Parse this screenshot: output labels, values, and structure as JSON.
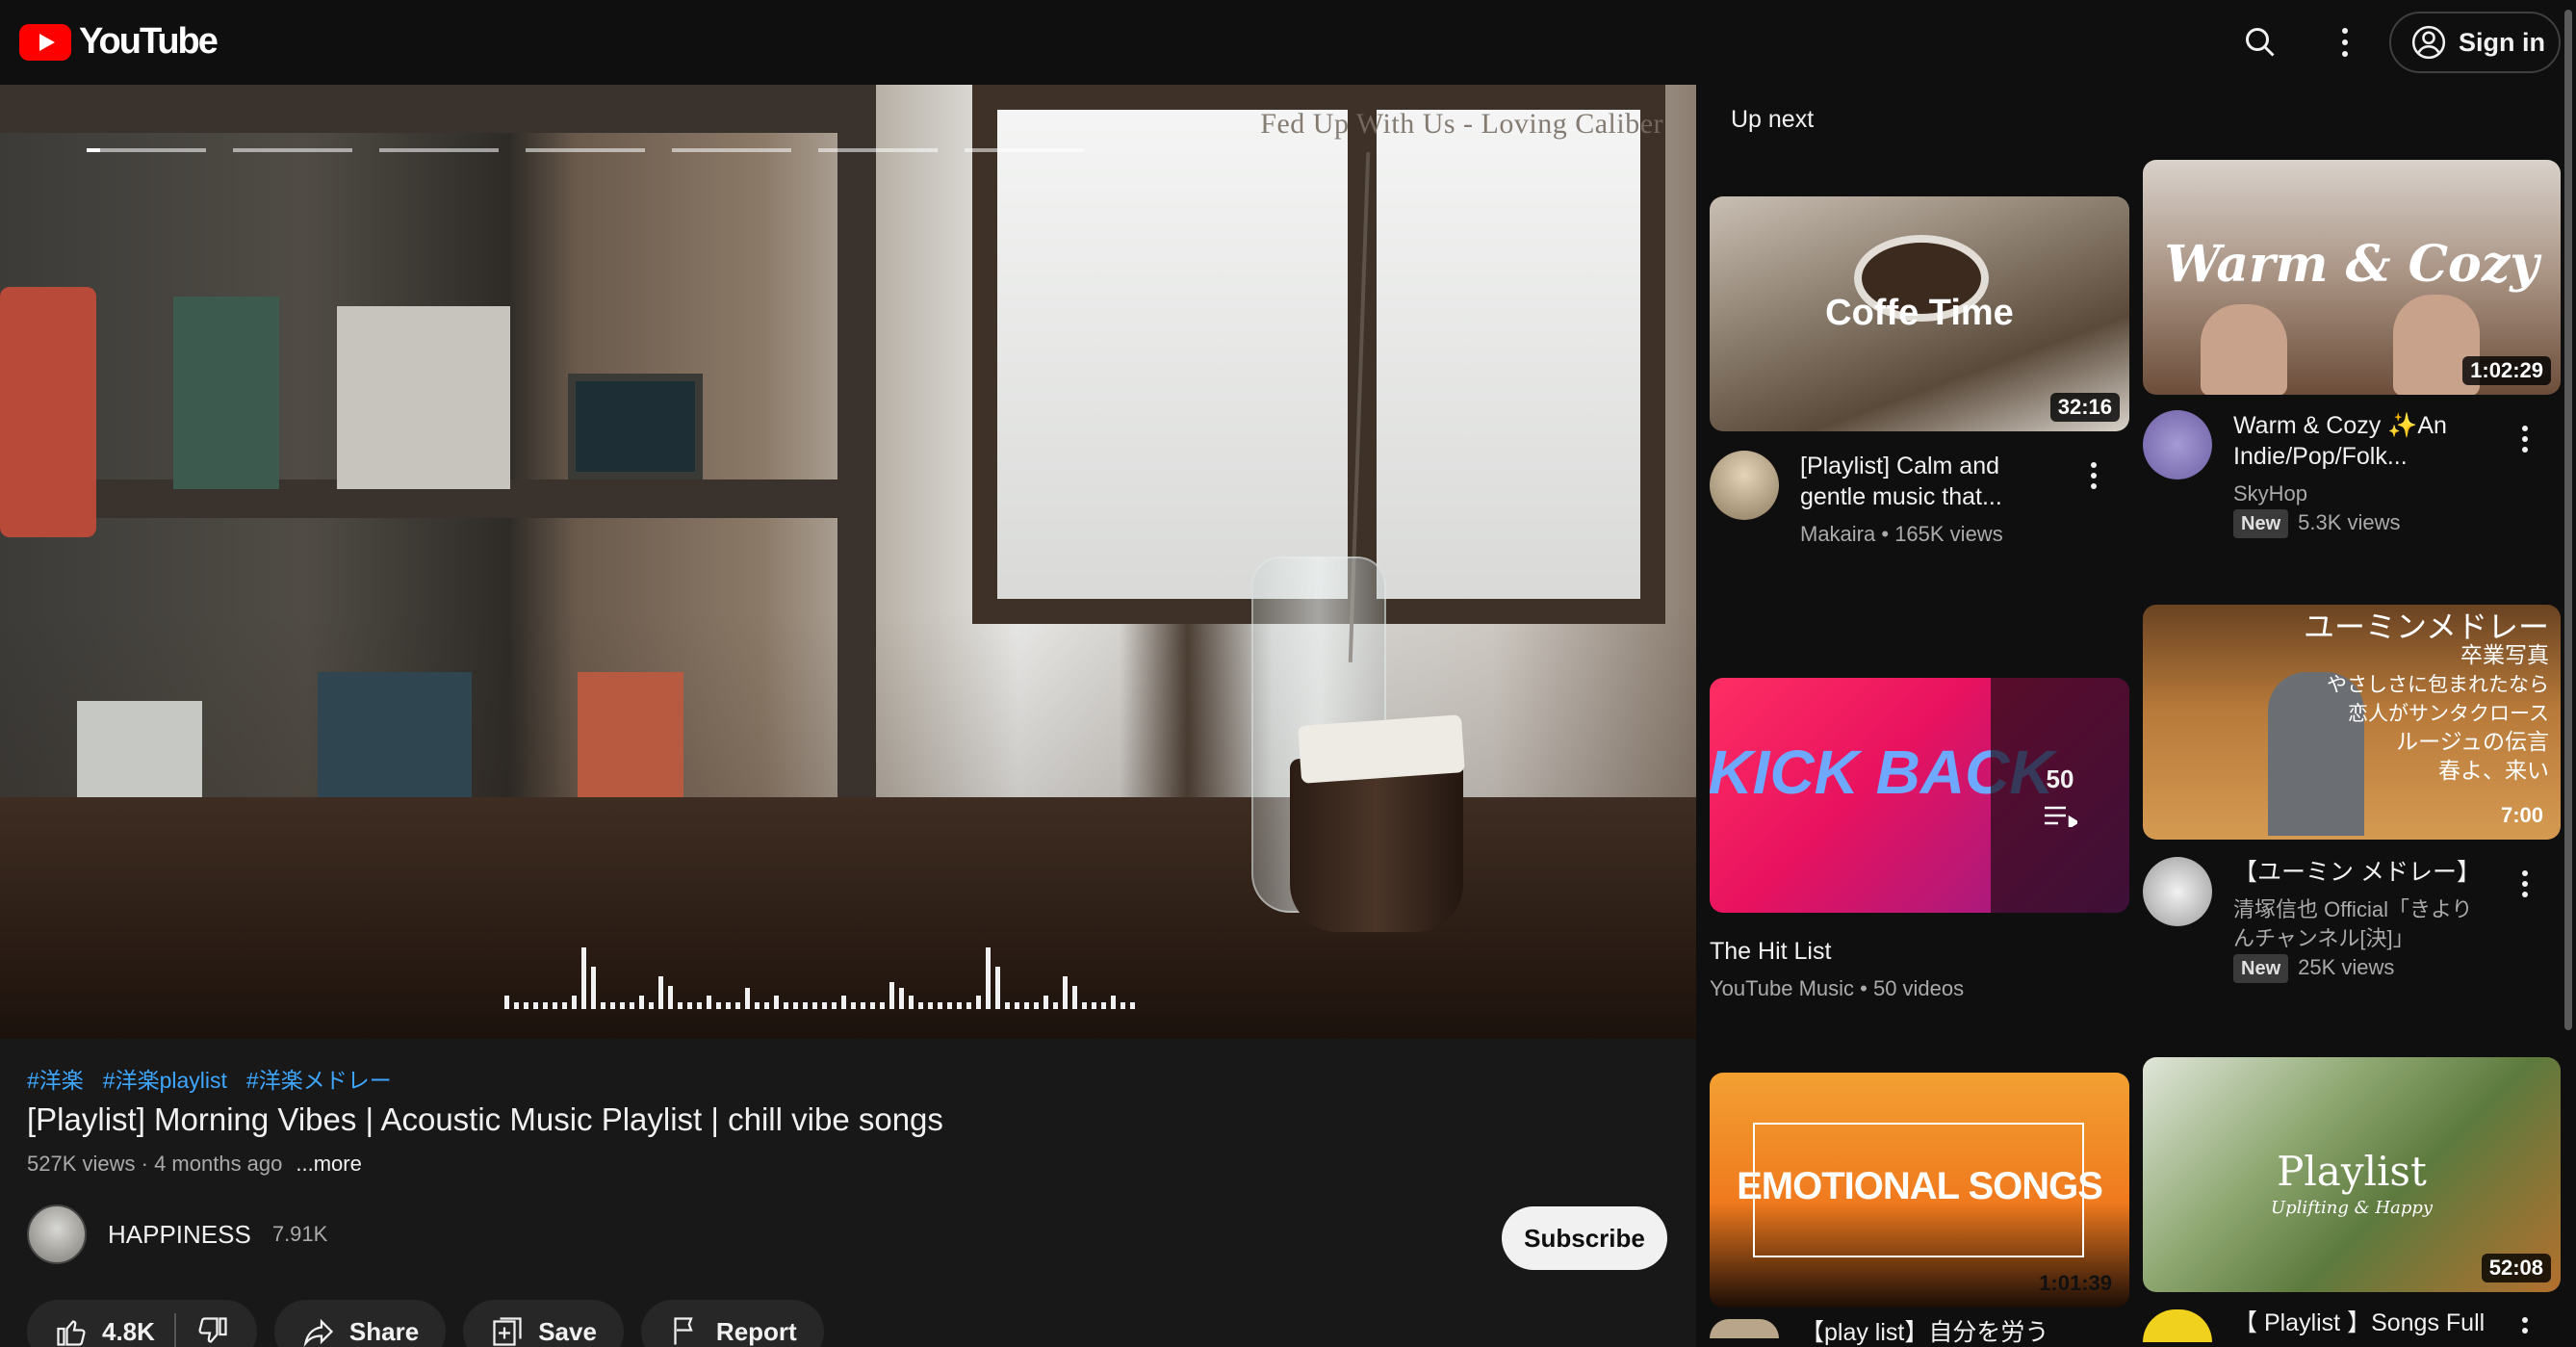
{
  "header": {
    "logo_text": "YouTube",
    "signin_label": "Sign in"
  },
  "player": {
    "overlay_title": "Fed Up With Us - Loving Caliber"
  },
  "video": {
    "tags": [
      "#洋楽",
      "#洋楽playlist",
      "#洋楽メドレー"
    ],
    "title": "[Playlist] Morning Vibes | Acoustic Music Playlist | chill vibe songs",
    "views": "527K views",
    "age": "4 months ago",
    "more_label": "...more",
    "channel_name": "HAPPINESS",
    "channel_subs": "7.91K",
    "subscribe_label": "Subscribe",
    "like_count": "4.8K",
    "share_label": "Share",
    "save_label": "Save",
    "report_label": "Report"
  },
  "sidebar": {
    "label": "Up next",
    "items": [
      {
        "thumb_text": "Coffe Time",
        "duration": "32:16",
        "title_line1": "[Playlist] Calm and",
        "title_line2": "gentle music that...",
        "channel": "Makaira",
        "stats": "165K views"
      },
      {
        "thumb_text": "Warm & Cozy",
        "duration": "1:02:29",
        "title_line1": "Warm & Cozy ✨An",
        "title_line2": "Indie/Pop/Folk...",
        "channel": "SkyHop",
        "badge": "New",
        "stats": "5.3K views"
      },
      {
        "thumb_text": "KICK BACK",
        "playlist_count": "50",
        "title": "The Hit List",
        "channel": "YouTube Music",
        "stats": "50 videos"
      },
      {
        "thumb_text_lines": [
          "ユーミンメドレー",
          "卒業写真",
          "やさしさに包まれたなら",
          "恋人がサンタクロース",
          "ルージュの伝言",
          "春よ、来い"
        ],
        "duration": "7:00",
        "title_line1": "【ユーミン メドレー】",
        "channel_line1": "清塚信也 Official「きより",
        "channel_line2": "んチャンネル[決]」",
        "badge": "New",
        "stats": "25K views"
      },
      {
        "thumb_text": "EMOTIONAL SONGS",
        "duration": "1:01:39",
        "title_line1": "【play list】自分を労う"
      },
      {
        "thumb_text": "Playlist",
        "thumb_subtext": "Uplifting & Happy",
        "duration": "52:08",
        "title_line1": "【 Playlist 】Songs Full"
      }
    ]
  },
  "colors": {
    "background": "#0f0f0f",
    "link": "#3ea6ff",
    "brand_red": "#ff0000"
  }
}
